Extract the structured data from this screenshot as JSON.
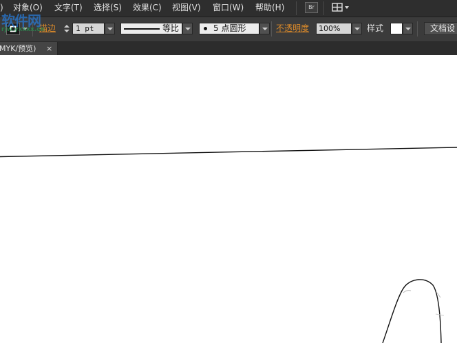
{
  "menubar": {
    "items": [
      "对象(O)",
      "文字(T)",
      "选择(S)",
      "效果(C)",
      "视图(V)",
      "窗口(W)",
      "帮助(H)"
    ],
    "leading_fragment": ")",
    "bridge_label": "Br"
  },
  "controlbar": {
    "stroke_label": "描边",
    "stroke_weight": "1 pt",
    "profile_label": "等比",
    "brush_label": "5 点圆形",
    "opacity_label": "不透明度",
    "opacity_value": "100%",
    "style_label": "样式",
    "doc_setup_label": "文档设"
  },
  "document_tab": {
    "title": "MYK/预览)",
    "close": "×"
  },
  "watermark": {
    "text": "软件网",
    "sub": "rjw.yxxxx.cn"
  },
  "colors": {
    "menubar_bg": "#2e2e2e",
    "controlbar_bg": "#3b3b3b",
    "accent_label": "#d9892a",
    "canvas_bg": "#ffffff"
  }
}
